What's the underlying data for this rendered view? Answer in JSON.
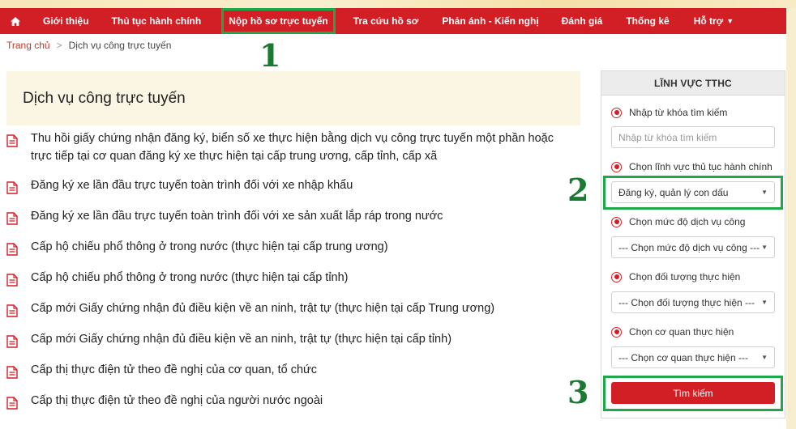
{
  "nav": {
    "items": [
      {
        "label": "Giới thiệu"
      },
      {
        "label": "Thủ tục hành chính"
      },
      {
        "label": "Nộp hồ sơ trực tuyến"
      },
      {
        "label": "Tra cứu hồ sơ"
      },
      {
        "label": "Phản ánh - Kiến nghị"
      },
      {
        "label": "Đánh giá"
      },
      {
        "label": "Thống kê"
      },
      {
        "label": "Hỗ trợ"
      }
    ],
    "home_icon": "home-icon",
    "dropdown_icon": "caret-down-icon"
  },
  "breadcrumb": {
    "home": "Trang chủ",
    "separator": ">",
    "current": "Dịch vụ công trực tuyến"
  },
  "main": {
    "title": "Dịch vụ công trực tuyến",
    "services": [
      {
        "text": "Thu hồi giấy chứng nhận đăng ký, biển số xe thực hiện bằng dịch vụ công trực tuyến một phần hoặc trực tiếp tại cơ quan đăng ký xe thực hiện tại cấp trung ương, cấp tỉnh, cấp xã"
      },
      {
        "text": "Đăng ký xe lần đầu trực tuyến toàn trình đối với xe nhập khẩu"
      },
      {
        "text": "Đăng ký xe lần đầu trực tuyến toàn trình đối với xe sản xuất lắp ráp trong nước"
      },
      {
        "text": "Cấp hộ chiếu phổ thông ở trong nước (thực hiện tại cấp trung ương)"
      },
      {
        "text": "Cấp hộ chiếu phổ thông ở trong nước (thực hiện tại cấp tỉnh)"
      },
      {
        "text": "Cấp mới Giấy chứng nhận đủ điều kiện về an ninh, trật tự (thực hiện tại cấp Trung ương)"
      },
      {
        "text": "Cấp mới Giấy chứng nhận đủ điều kiện về an ninh, trật tự (thực hiện tại cấp tỉnh)"
      },
      {
        "text": "Cấp thị thực điện tử theo đề nghị của cơ quan, tổ chức"
      },
      {
        "text": "Cấp thị thực điện tử theo đề nghị của người nước ngoài"
      }
    ],
    "item_icon": "document-icon"
  },
  "sidebar": {
    "title": "LĨNH VỰC TTHC",
    "keyword_label": "Nhập từ khóa tìm kiếm",
    "keyword_placeholder": "Nhập từ khóa tìm kiếm",
    "field_label": "Chọn lĩnh vực thủ tục hành chính",
    "field_value": "Đăng ký, quản lý con dấu",
    "level_label": "Chọn mức độ dịch vụ công",
    "level_value": "--- Chọn mức độ dịch vụ công ---",
    "subject_label": "Chọn đối tượng thực hiện",
    "subject_value": "--- Chọn đối tượng thực hiện ---",
    "agency_label": "Chọn cơ quan thực hiện",
    "agency_value": "--- Chọn cơ quan thực hiện ---",
    "search_button": "Tìm kiếm"
  },
  "annotations": {
    "step1": "1",
    "step2": "2",
    "step3": "3"
  },
  "colors": {
    "nav_red": "#d21f26",
    "highlight_green": "#1fa84a",
    "annotation_green": "#1a7a32",
    "title_bg": "#fbf5e3"
  }
}
